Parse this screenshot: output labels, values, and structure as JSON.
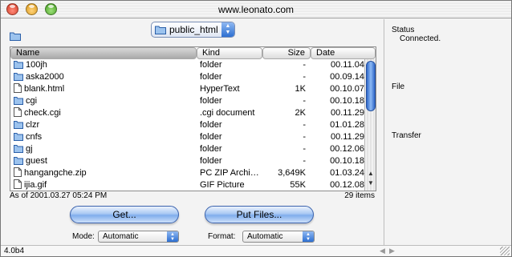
{
  "window": {
    "title": "www.leonato.com"
  },
  "folder_popup": {
    "selected": "public_html"
  },
  "list": {
    "columns": [
      {
        "key": "name",
        "label": "Name"
      },
      {
        "key": "kind",
        "label": "Kind"
      },
      {
        "key": "size",
        "label": "Size"
      },
      {
        "key": "date",
        "label": "Date"
      }
    ],
    "rows": [
      {
        "icon": "folder-icon",
        "name": "100jh",
        "kind": "folder",
        "size": "-",
        "date": "00.11.04"
      },
      {
        "icon": "folder-icon",
        "name": "aska2000",
        "kind": "folder",
        "size": "-",
        "date": "00.09.14"
      },
      {
        "icon": "document-icon",
        "name": "blank.html",
        "kind": "HyperText",
        "size": "1K",
        "date": "00.10.07"
      },
      {
        "icon": "folder-icon",
        "name": "cgi",
        "kind": "folder",
        "size": "-",
        "date": "00.10.18"
      },
      {
        "icon": "document-icon",
        "name": "check.cgi",
        "kind": ".cgi document",
        "size": "2K",
        "date": "00.11.29"
      },
      {
        "icon": "folder-icon",
        "name": "clzr",
        "kind": "folder",
        "size": "-",
        "date": "01.01.28"
      },
      {
        "icon": "folder-icon",
        "name": "cnfs",
        "kind": "folder",
        "size": "-",
        "date": "00.11.29"
      },
      {
        "icon": "folder-icon",
        "name": "gj",
        "kind": "folder",
        "size": "-",
        "date": "00.12.06"
      },
      {
        "icon": "folder-icon",
        "name": "guest",
        "kind": "folder",
        "size": "-",
        "date": "00.10.18"
      },
      {
        "icon": "document-icon",
        "name": "hangangche.zip",
        "kind": "PC ZIP Archi…",
        "size": "3,649K",
        "date": "01.03.24"
      },
      {
        "icon": "document-icon",
        "name": "ijia.gif",
        "kind": "GIF Picture",
        "size": "55K",
        "date": "00.12.08"
      }
    ]
  },
  "status_bar": {
    "timestamp": "As of 2001.03.27 05:24 PM",
    "item_count": "29 items"
  },
  "buttons": {
    "get": "Get...",
    "put": "Put Files..."
  },
  "mode": {
    "label": "Mode:",
    "value": "Automatic"
  },
  "format": {
    "label": "Format:",
    "value": "Automatic"
  },
  "side_panel": {
    "status_label": "Status",
    "status_value": "Connected.",
    "file_label": "File",
    "transfer_label": "Transfer"
  },
  "footer": {
    "version": "4.0b4"
  },
  "colors": {
    "accent": "#2d6fd1",
    "selection_header": "#a9a9a9"
  }
}
